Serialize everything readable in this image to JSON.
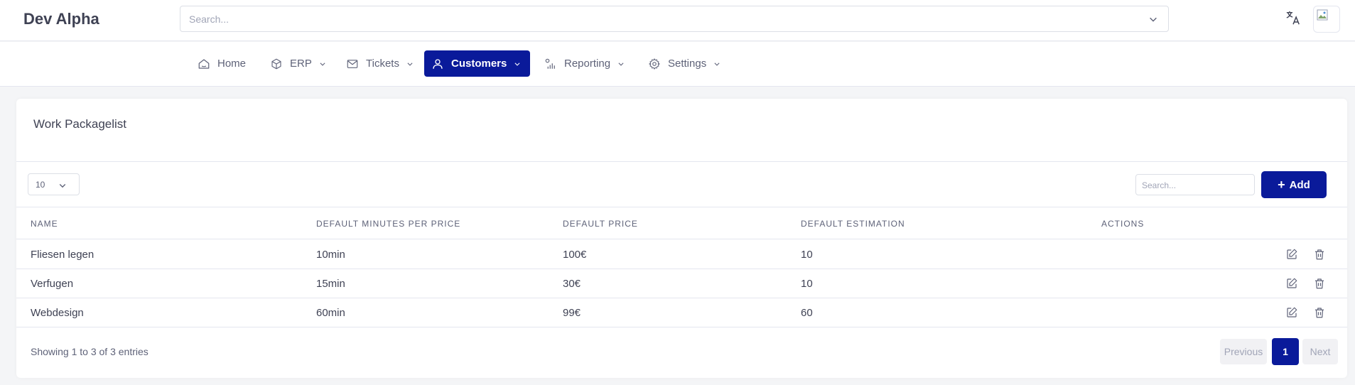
{
  "header": {
    "brand": "Dev Alpha",
    "search_placeholder": "Search..."
  },
  "nav": {
    "items": [
      {
        "label": "Home",
        "icon": "home-icon",
        "dropdown": false,
        "active": false
      },
      {
        "label": "ERP",
        "icon": "cube-icon",
        "dropdown": true,
        "active": false
      },
      {
        "label": "Tickets",
        "icon": "mail-icon",
        "dropdown": true,
        "active": false
      },
      {
        "label": "Customers",
        "icon": "user-icon",
        "dropdown": true,
        "active": true
      },
      {
        "label": "Reporting",
        "icon": "chart-icon",
        "dropdown": true,
        "active": false
      },
      {
        "label": "Settings",
        "icon": "gear-icon",
        "dropdown": true,
        "active": false
      }
    ]
  },
  "card": {
    "title": "Work Packagelist",
    "page_length": "10",
    "search_placeholder": "Search...",
    "add_label": "Add"
  },
  "table": {
    "columns": [
      "NAME",
      "DEFAULT MINUTES PER PRICE",
      "DEFAULT PRICE",
      "DEFAULT ESTIMATION",
      "ACTIONS"
    ],
    "rows": [
      {
        "name": "Fliesen legen",
        "minutes": "10min",
        "price": "100€",
        "estimation": "10"
      },
      {
        "name": "Verfugen",
        "minutes": "15min",
        "price": "30€",
        "estimation": "10"
      },
      {
        "name": "Webdesign",
        "minutes": "60min",
        "price": "99€",
        "estimation": "60"
      }
    ]
  },
  "pagination": {
    "info": "Showing 1 to 3 of 3 entries",
    "previous": "Previous",
    "current": "1",
    "next": "Next"
  },
  "colors": {
    "accent": "#0a1a9a",
    "background": "#f4f5f7",
    "text": "#3f4254"
  }
}
